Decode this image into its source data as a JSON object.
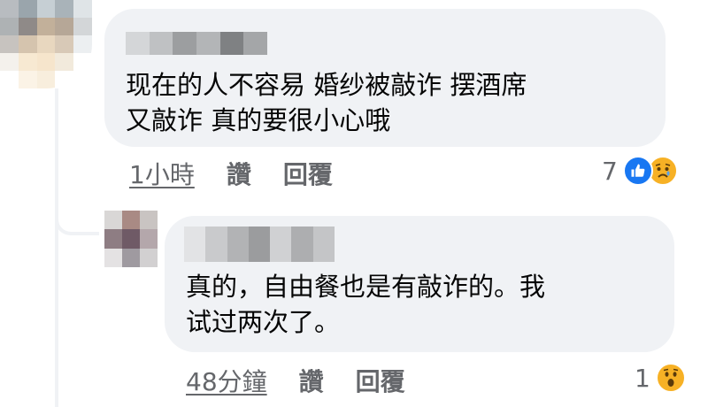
{
  "comment": {
    "text": "现在的人不容易 婚纱被敲诈 摆酒席\n又敲诈 真的要很小心哦",
    "timestamp": "1小時",
    "like_label": "讚",
    "reply_label": "回覆",
    "reaction_count": "7",
    "reactions": [
      "like-icon",
      "sad-icon"
    ]
  },
  "reply": {
    "text": "真的，自由餐也是有敲诈的。我\n试过两次了。",
    "timestamp": "48分鐘",
    "like_label": "讚",
    "reply_label": "回覆",
    "reaction_count": "1",
    "reactions": [
      "wow-icon"
    ]
  },
  "colors": {
    "bubble": "#f0f2f5",
    "meta_text": "#65676b",
    "like_blue": "#1877f2",
    "emoji_yellow": "#f7b125"
  }
}
